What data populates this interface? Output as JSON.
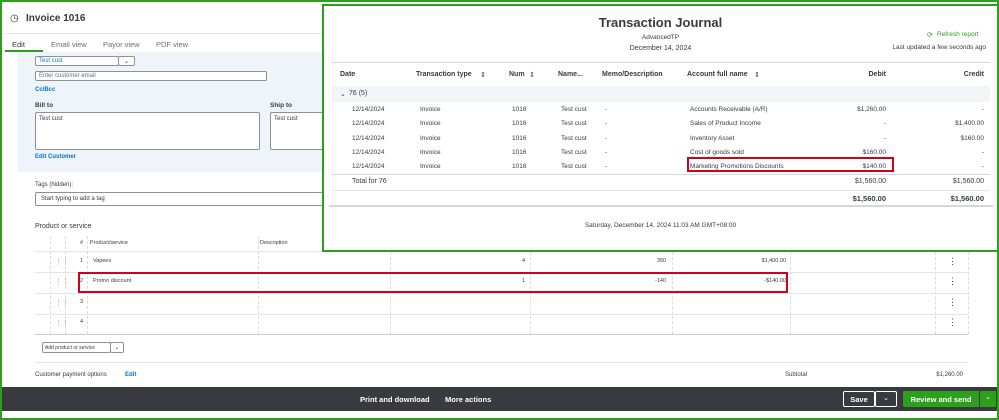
{
  "invoice": {
    "title": "Invoice 1016",
    "tabs": [
      "Edit",
      "Email view",
      "Payor view",
      "PDF view"
    ],
    "customer": "Test cust",
    "email_placeholder": "Enter customer email",
    "cc_bcc": "Cc/Bcc",
    "bill_to_label": "Bill to",
    "bill_to": "Test cust",
    "ship_to_label": "Ship to",
    "ship_to": "Test cust",
    "edit_customer": "Edit Customer",
    "tags_label": "Tags (hidden):",
    "tags_placeholder": "Start typing to add a tag",
    "section": "Product or service",
    "col_num": "#",
    "col_product": "Product/service",
    "col_desc": "Description",
    "lines": [
      {
        "n": "1",
        "product": "Vapees",
        "qty": "4",
        "rate": "350",
        "amount": "$1,400.00"
      },
      {
        "n": "2",
        "product": "Promo discount",
        "qty": "1",
        "rate": "-140",
        "amount": "-$140.00"
      },
      {
        "n": "3"
      },
      {
        "n": "4"
      }
    ],
    "add_line": "Add product or service",
    "payment_options": "Customer payment options",
    "payment_edit": "Edit",
    "subtotal_label": "Subtotal",
    "subtotal": "$1,260.00"
  },
  "footer": {
    "print": "Print and download",
    "more": "More actions",
    "save": "Save",
    "review": "Review and send"
  },
  "report": {
    "title": "Transaction Journal",
    "company": "AdvancedTP",
    "date": "December 14, 2024",
    "refresh": "Refresh report",
    "updated": "Last updated a few seconds ago",
    "headers": [
      "Date",
      "Transaction type",
      "Num",
      "Name...",
      "Memo/Description",
      "Account full name",
      "Debit",
      "Credit"
    ],
    "group": "76 (5)",
    "rows": [
      [
        "12/14/2024",
        "Invoice",
        "1016",
        "Test cust",
        "-",
        "Accounts Receivable (A/R)",
        "$1,260.00",
        "-"
      ],
      [
        "12/14/2024",
        "Invoice",
        "1016",
        "Test cust",
        "-",
        "Sales of Product Income",
        "-",
        "$1,400.00"
      ],
      [
        "12/14/2024",
        "Invoice",
        "1016",
        "Test cust",
        "-",
        "Inventory Asset",
        "-",
        "$160.00"
      ],
      [
        "12/14/2024",
        "Invoice",
        "1016",
        "Test cust",
        "-",
        "Cost of goods sold",
        "$160.00",
        "-"
      ],
      [
        "12/14/2024",
        "Invoice",
        "1016",
        "Test cust",
        "-",
        "Marketing Promotions Discounts",
        "$140.00",
        "-"
      ]
    ],
    "total_label": "Total for 76",
    "total_debit": "$1,560.00",
    "total_credit": "$1,560.00",
    "grand_debit": "$1,560.00",
    "grand_credit": "$1,560.00",
    "timestamp": "Saturday, December 14, 2024 11:03 AM GMT+08:00"
  }
}
